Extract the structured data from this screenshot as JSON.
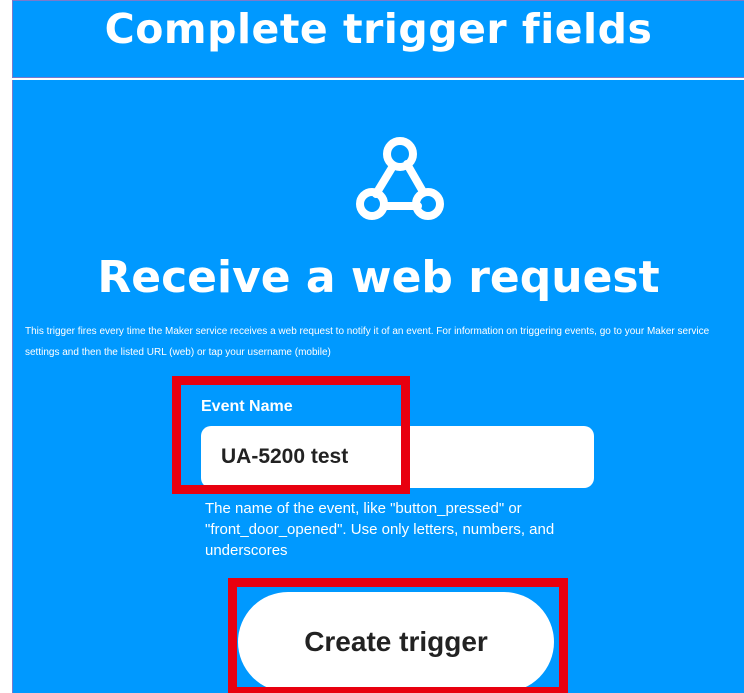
{
  "header": {
    "title": "Complete trigger fields"
  },
  "service": {
    "icon": "webhooks-icon",
    "title": "Receive a web request",
    "description": "This trigger fires every time the Maker service receives a web request to notify it of an event. For information on triggering events, go to your Maker service settings and then the listed URL (web) or tap your username (mobile)"
  },
  "event_field": {
    "label": "Event Name",
    "value": "UA-5200 test",
    "help": "The name of the event, like \"button_pressed\" or \"front_door_opened\". Use only letters, numbers, and underscores"
  },
  "actions": {
    "create_label": "Create trigger"
  },
  "colors": {
    "panel_background": "#0099ff",
    "highlight": "#e8000f",
    "text": "#ffffff"
  }
}
